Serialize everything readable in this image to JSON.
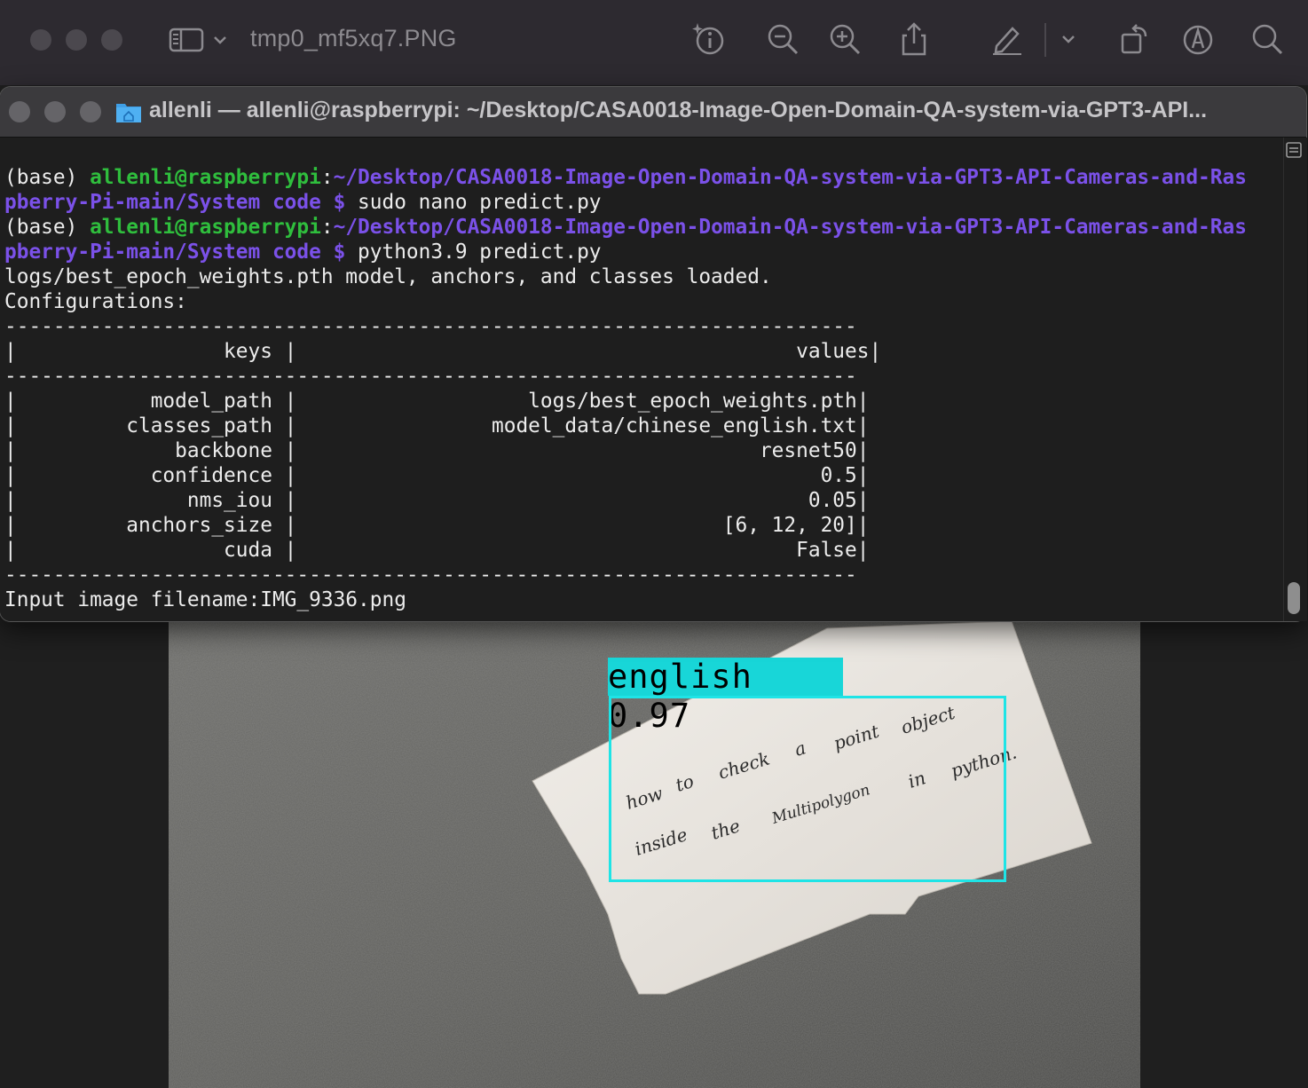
{
  "viewer": {
    "filename": "tmp0_mf5xq7.PNG",
    "toolbar_icons": [
      "sidebar-toggle-icon",
      "chevron-down-icon",
      "info-sparkle-icon",
      "zoom-out-icon",
      "zoom-in-icon",
      "share-icon",
      "markup-pen-icon",
      "chevron-down-icon",
      "rotate-icon",
      "markup-circle-icon",
      "search-icon"
    ]
  },
  "terminal": {
    "title": "allenli — allenli@raspberrypi: ~/Desktop/CASA0018-Image-Open-Domain-QA-system-via-GPT3-API...",
    "prompt": {
      "env": "(base) ",
      "user": "allenli@raspberrypi",
      "colon": ":",
      "path_line1": "~/Desktop/CASA0018-Image-Open-Domain-QA-system-via-GPT3-API-Cameras-and-Ras",
      "path_line2": "pberry-Pi-main/System code $",
      "cmd1": " sudo nano predict.py",
      "cmd2": " python3.9 predict.py"
    },
    "output": {
      "loaded": "logs/best_epoch_weights.pth model, anchors, and classes loaded.",
      "config_header": "Configurations:",
      "rule": "----------------------------------------------------------------------",
      "table_header": "|                 keys |                                         values|",
      "rows": [
        "|           model_path |                   logs/best_epoch_weights.pth|",
        "|         classes_path |                model_data/chinese_english.txt|",
        "|             backbone |                                      resnet50|",
        "|           confidence |                                           0.5|",
        "|              nms_iou |                                          0.05|",
        "|         anchors_size |                                   [6, 12, 20]|",
        "|                 cuda |                                         False|"
      ],
      "input_prompt": "Input image filename:IMG_9336.png"
    }
  },
  "detection": {
    "label": "english 0.97",
    "box_color": "#1ee4e6",
    "note_text": [
      "how",
      "to",
      "check",
      "a",
      "point",
      "object",
      "inside",
      "the",
      "Multipolygon",
      "in",
      "python."
    ]
  }
}
